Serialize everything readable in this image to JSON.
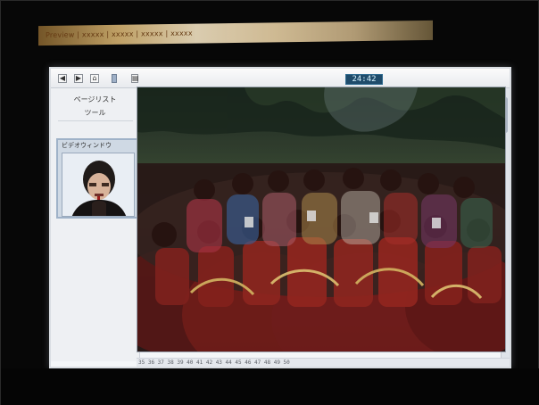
{
  "top_banner": {
    "text": "Preview  |  xxxxx  |  xxxxx  |  xxxxx  |  xxxxx"
  },
  "toolbar": {
    "back_label": "◀",
    "forward_label": "▶",
    "home_label": "⌂",
    "divider_label": "",
    "menu_label": "▤",
    "clock_text": "24:42"
  },
  "sidebar": {
    "title": "ページリスト",
    "tool": "ツール"
  },
  "video_window": {
    "label": "ビデオウィンドウ"
  },
  "bottom_bar": {
    "page_numbers": "35  36  37  38  39  40  41  42  43  44  45  46  47  48  49  50"
  }
}
